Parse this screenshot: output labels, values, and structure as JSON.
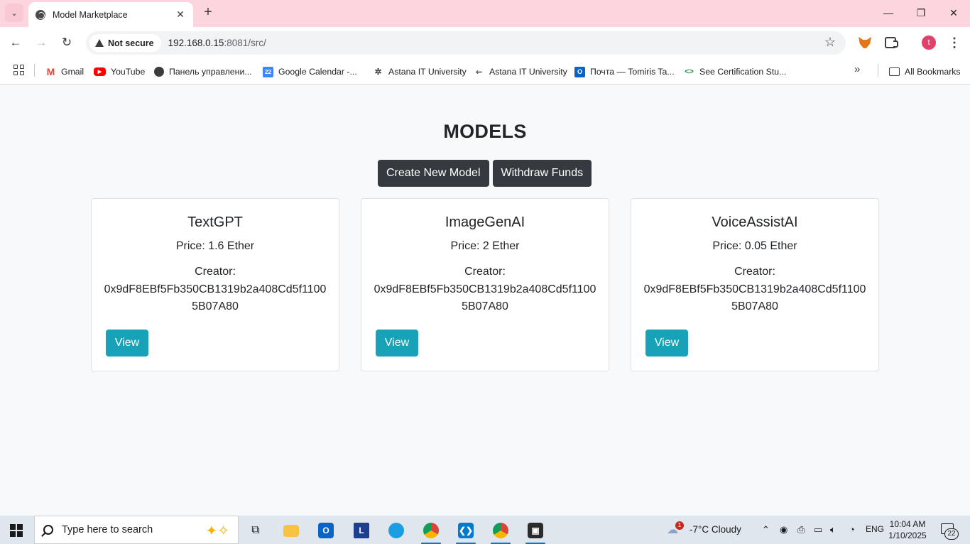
{
  "browser": {
    "tab_title": "Model Marketplace",
    "security_label": "Not secure",
    "url_host": "192.168.0.15",
    "url_rest": ":8081/src/",
    "profile_initial": "t"
  },
  "bookmarks": {
    "items": [
      {
        "label": "Gmail",
        "icon": "gmail-icon"
      },
      {
        "label": "YouTube",
        "icon": "youtube-icon"
      },
      {
        "label": "Панель управлени...",
        "icon": "globe-icon"
      },
      {
        "label": "Google Calendar -...",
        "icon": "calendar-icon"
      },
      {
        "label": "Astana IT University",
        "icon": "aitu-icon"
      },
      {
        "label": "Astana IT University",
        "icon": "aitu-icon"
      },
      {
        "label": "Почта — Tomiris Ta...",
        "icon": "outlook-icon"
      },
      {
        "label": "See Certification Stu...",
        "icon": "code-icon"
      }
    ],
    "all_bookmarks": "All Bookmarks"
  },
  "page": {
    "title": "MODELS",
    "create_button": "Create New Model",
    "withdraw_button": "Withdraw Funds",
    "creator_label": "Creator:",
    "view_label": "View",
    "models": [
      {
        "name": "TextGPT",
        "price": "Price: 1.6 Ether",
        "creator": "0x9dF8EBf5Fb350CB1319b2a408Cd5f11005B07A80"
      },
      {
        "name": "ImageGenAI",
        "price": "Price: 2 Ether",
        "creator": "0x9dF8EBf5Fb350CB1319b2a408Cd5f11005B07A80"
      },
      {
        "name": "VoiceAssistAI",
        "price": "Price: 0.05 Ether",
        "creator": "0x9dF8EBf5Fb350CB1319b2a408Cd5f11005B07A80"
      }
    ]
  },
  "taskbar": {
    "search_placeholder": "Type here to search",
    "weather": "-7°C  Cloudy",
    "weather_badge": "1",
    "language": "ENG",
    "time": "10:04 AM",
    "date": "1/10/2025",
    "notification_count": "22"
  },
  "colors": {
    "tabstrip": "#fdd5df",
    "dark_button": "#343a40",
    "view_button": "#17a2b8",
    "page_bg": "#f8f9fa"
  }
}
